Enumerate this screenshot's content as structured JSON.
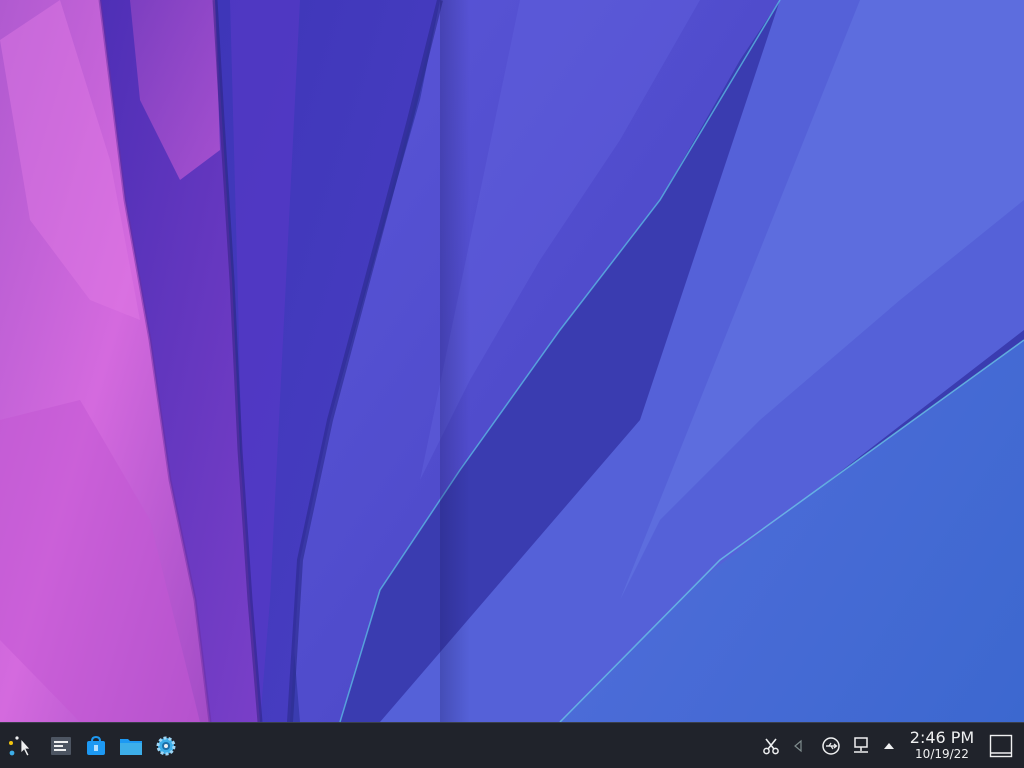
{
  "desktop": {
    "wallpaper_name": "polygonal-fan-wallpaper",
    "colors": {
      "left_pink": "#c85fd3",
      "mid_purple": "#4b37b8",
      "right_blue": "#5a78de",
      "deep_blue": "#2c2f9e"
    }
  },
  "taskbar": {
    "background": "#20232b",
    "launchers": [
      {
        "name": "application-launcher-icon",
        "tooltip": "Application Launcher"
      },
      {
        "name": "system-settings-panel-icon",
        "tooltip": "System Settings"
      },
      {
        "name": "discover-store-icon",
        "tooltip": "Discover"
      },
      {
        "name": "dolphin-file-manager-icon",
        "tooltip": "Dolphin"
      },
      {
        "name": "settings-gear-icon",
        "tooltip": "Settings"
      }
    ],
    "tray": {
      "icons": [
        {
          "name": "clipboard-scissors-icon"
        },
        {
          "name": "volume-speaker-icon"
        },
        {
          "name": "usb-device-icon"
        },
        {
          "name": "network-wired-icon"
        },
        {
          "name": "tray-expand-arrow-icon"
        }
      ]
    },
    "clock": {
      "time": "2:46 PM",
      "date": "10/19/22"
    },
    "show_desktop": {
      "name": "show-desktop-icon"
    }
  }
}
